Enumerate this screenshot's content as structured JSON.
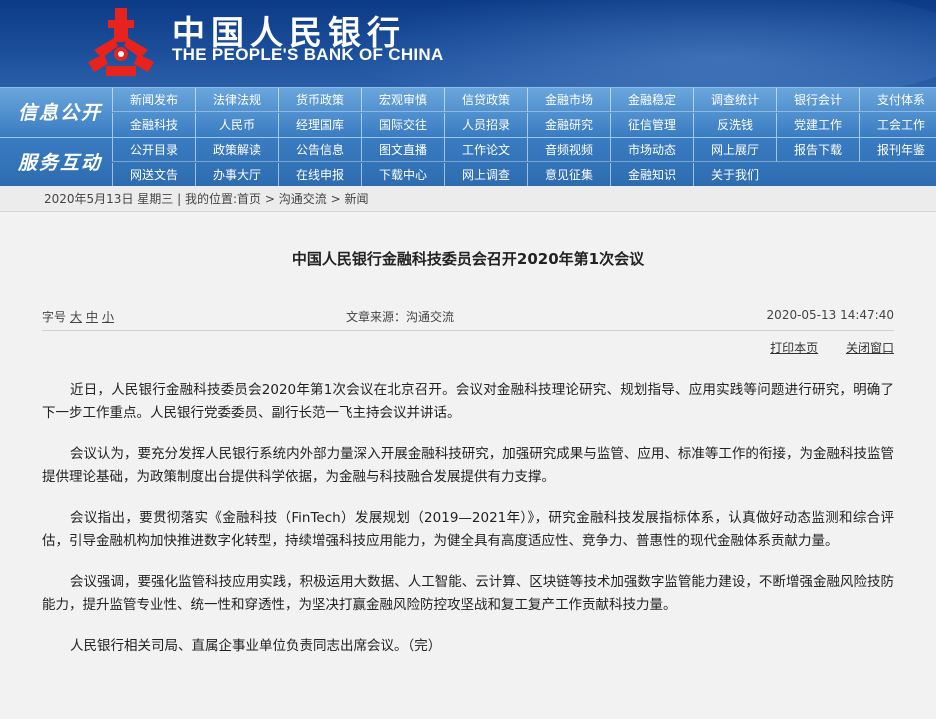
{
  "header": {
    "cn_name": "中国人民银行",
    "en_name": "THE PEOPLE'S BANK OF CHINA",
    "logo_color": "#e8221c"
  },
  "nav": {
    "group1_title": "信息公开",
    "group2_title": "服务互动",
    "row1": [
      "新闻发布",
      "法律法规",
      "货币政策",
      "宏观审慎",
      "信贷政策",
      "金融市场",
      "金融稳定",
      "调查统计",
      "银行会计",
      "支付体系"
    ],
    "row2": [
      "金融科技",
      "人民币",
      "经理国库",
      "国际交往",
      "人员招录",
      "金融研究",
      "征信管理",
      "反洗钱",
      "党建工作",
      "工会工作"
    ],
    "row3": [
      "公开目录",
      "政策解读",
      "公告信息",
      "图文直播",
      "工作论文",
      "音频视频",
      "市场动态",
      "网上展厅",
      "报告下载",
      "报刊年鉴"
    ],
    "row4": [
      "网送文告",
      "办事大厅",
      "在线申报",
      "下载中心",
      "网上调查",
      "意见征集",
      "金融知识",
      "关于我们"
    ]
  },
  "breadcrumb": {
    "date": "2020年5月13日",
    "weekday": "星期三",
    "sep": "|",
    "location_label": "我的位置:",
    "home": "首页",
    "arrow": ">",
    "section": "沟通交流",
    "page": "新闻"
  },
  "article": {
    "title": "中国人民银行金融科技委员会召开2020年第1次会议",
    "font_label": "字号",
    "font_large": "大",
    "font_medium": "中",
    "font_small": "小",
    "source": "文章来源：沟通交流",
    "datetime": "2020-05-13 14:47:40",
    "print_link": "打印本页",
    "close_link": "关闭窗口",
    "paragraphs": [
      "近日，人民银行金融科技委员会2020年第1次会议在北京召开。会议对金融科技理论研究、规划指导、应用实践等问题进行研究，明确了下一步工作重点。人民银行党委委员、副行长范一飞主持会议并讲话。",
      "会议认为，要充分发挥人民银行系统内外部力量深入开展金融科技研究，加强研究成果与监管、应用、标准等工作的衔接，为金融科技监管提供理论基础，为政策制度出台提供科学依据，为金融与科技融合发展提供有力支撑。",
      "会议指出，要贯彻落实《金融科技（FinTech）发展规划（2019—2021年）》，研究金融科技发展指标体系，认真做好动态监测和综合评估，引导金融机构加快推进数字化转型，持续增强科技应用能力，为健全具有高度适应性、竞争力、普惠性的现代金融体系贡献力量。",
      "会议强调，要强化监管科技应用实践，积极运用大数据、人工智能、云计算、区块链等技术加强数字监管能力建设，不断增强金融风险技防能力，提升监管专业性、统一性和穿透性，为坚决打赢金融风险防控攻坚战和复工复产工作贡献科技力量。",
      "人民银行相关司局、直属企事业单位负责同志出席会议。（完）"
    ]
  }
}
